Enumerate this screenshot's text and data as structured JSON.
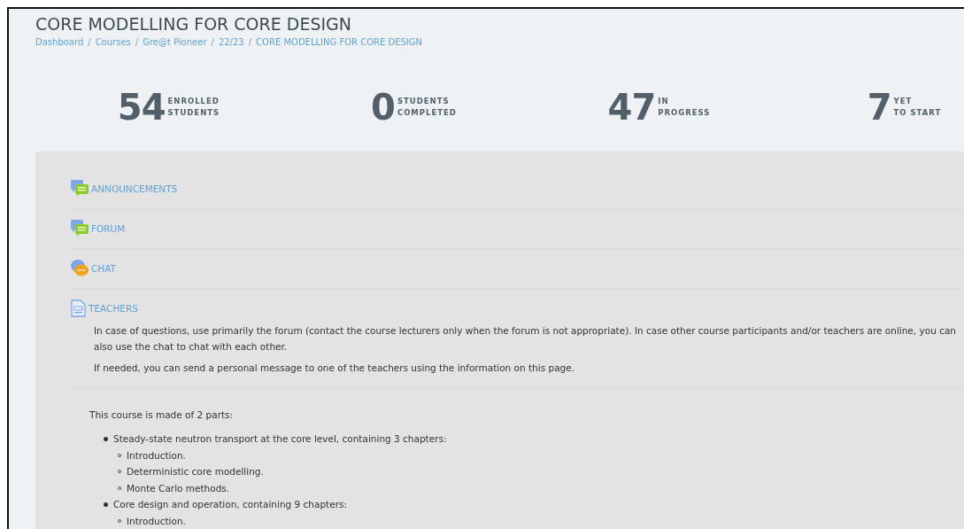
{
  "page": {
    "title": "CORE MODELLING FOR CORE DESIGN"
  },
  "breadcrumb": [
    {
      "label": "Dashboard"
    },
    {
      "separator": "/",
      "label": "Courses"
    },
    {
      "separator": "/",
      "label": "Gre@t Pioneer"
    },
    {
      "separator": "/",
      "label": "22/23"
    },
    {
      "separator": "/",
      "label": "CORE MODELLING FOR CORE DESIGN"
    }
  ],
  "stats": [
    {
      "value": "54",
      "line1": "ENROLLED",
      "line2": "STUDENTS"
    },
    {
      "value": "0",
      "line1": "STUDENTS",
      "line2": "COMPLETED"
    },
    {
      "value": "47",
      "line1": "IN",
      "line2": "PROGRESS"
    },
    {
      "value": "7",
      "line1": "YET",
      "line2": "TO START"
    }
  ],
  "activities": [
    {
      "kind": "forum",
      "label": "ANNOUNCEMENTS"
    },
    {
      "kind": "forum",
      "label": "FORUM"
    },
    {
      "kind": "chat",
      "label": "CHAT"
    },
    {
      "kind": "page",
      "label": "TEACHERS",
      "paragraphs": [
        "In case of questions, use primarily the forum (contact the course lecturers only when the forum is not appropriate). In case other course participants and/or teachers are online, you can also use the chat to chat with each other.",
        "If needed, you can send a personal message to one of the teachers using the information on this page."
      ]
    }
  ],
  "summary": {
    "intro": "This course is made of 2 parts:",
    "parts": [
      {
        "text": "Steady-state neutron transport at the core level, containing 3 chapters:",
        "children": [
          {
            "text": "Introduction."
          },
          {
            "text": "Deterministic core modelling."
          },
          {
            "text": "Monte Carlo methods."
          }
        ]
      },
      {
        "text": "Core design and operation, containing 9 chapters:",
        "children": [
          {
            "text": "Introduction."
          }
        ]
      }
    ]
  }
}
